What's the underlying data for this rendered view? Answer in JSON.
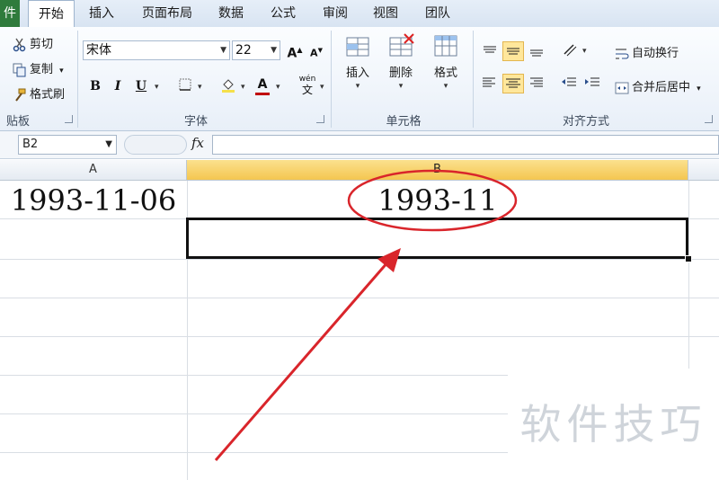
{
  "tabs": [
    "件",
    "开始",
    "插入",
    "页面布局",
    "数据",
    "公式",
    "审阅",
    "视图",
    "团队"
  ],
  "clipboard": {
    "cut_label": "剪切",
    "copy_label": "复制",
    "format_painter_label": "格式刷",
    "group_label": "贴板"
  },
  "font": {
    "font_name": "宋体",
    "font_size": "22",
    "bold": "B",
    "italic": "I",
    "underline": "U",
    "group_label": "字体",
    "grow_label": "A",
    "shrink_label": "A",
    "color_label": "A",
    "phonetic_label": "wén"
  },
  "cells_group": {
    "insert_label": "插入",
    "delete_label": "删除",
    "format_label": "格式",
    "group_label": "单元格"
  },
  "alignment": {
    "wrap_text_label": "自动换行",
    "merge_center_label": "合并后居中",
    "group_label": "对齐方式"
  },
  "formula_bar": {
    "name_box": "B2",
    "fx_label": "fx",
    "formula_value": ""
  },
  "columns": [
    "A",
    "B"
  ],
  "cells": {
    "a1": "1993-11-06",
    "b1": "1993-11",
    "b2": ""
  },
  "watermark": "软件技巧",
  "colors": {
    "annotation": "#d9252b",
    "selected_header": "#f4c650",
    "active_button": "#ffe79b"
  }
}
